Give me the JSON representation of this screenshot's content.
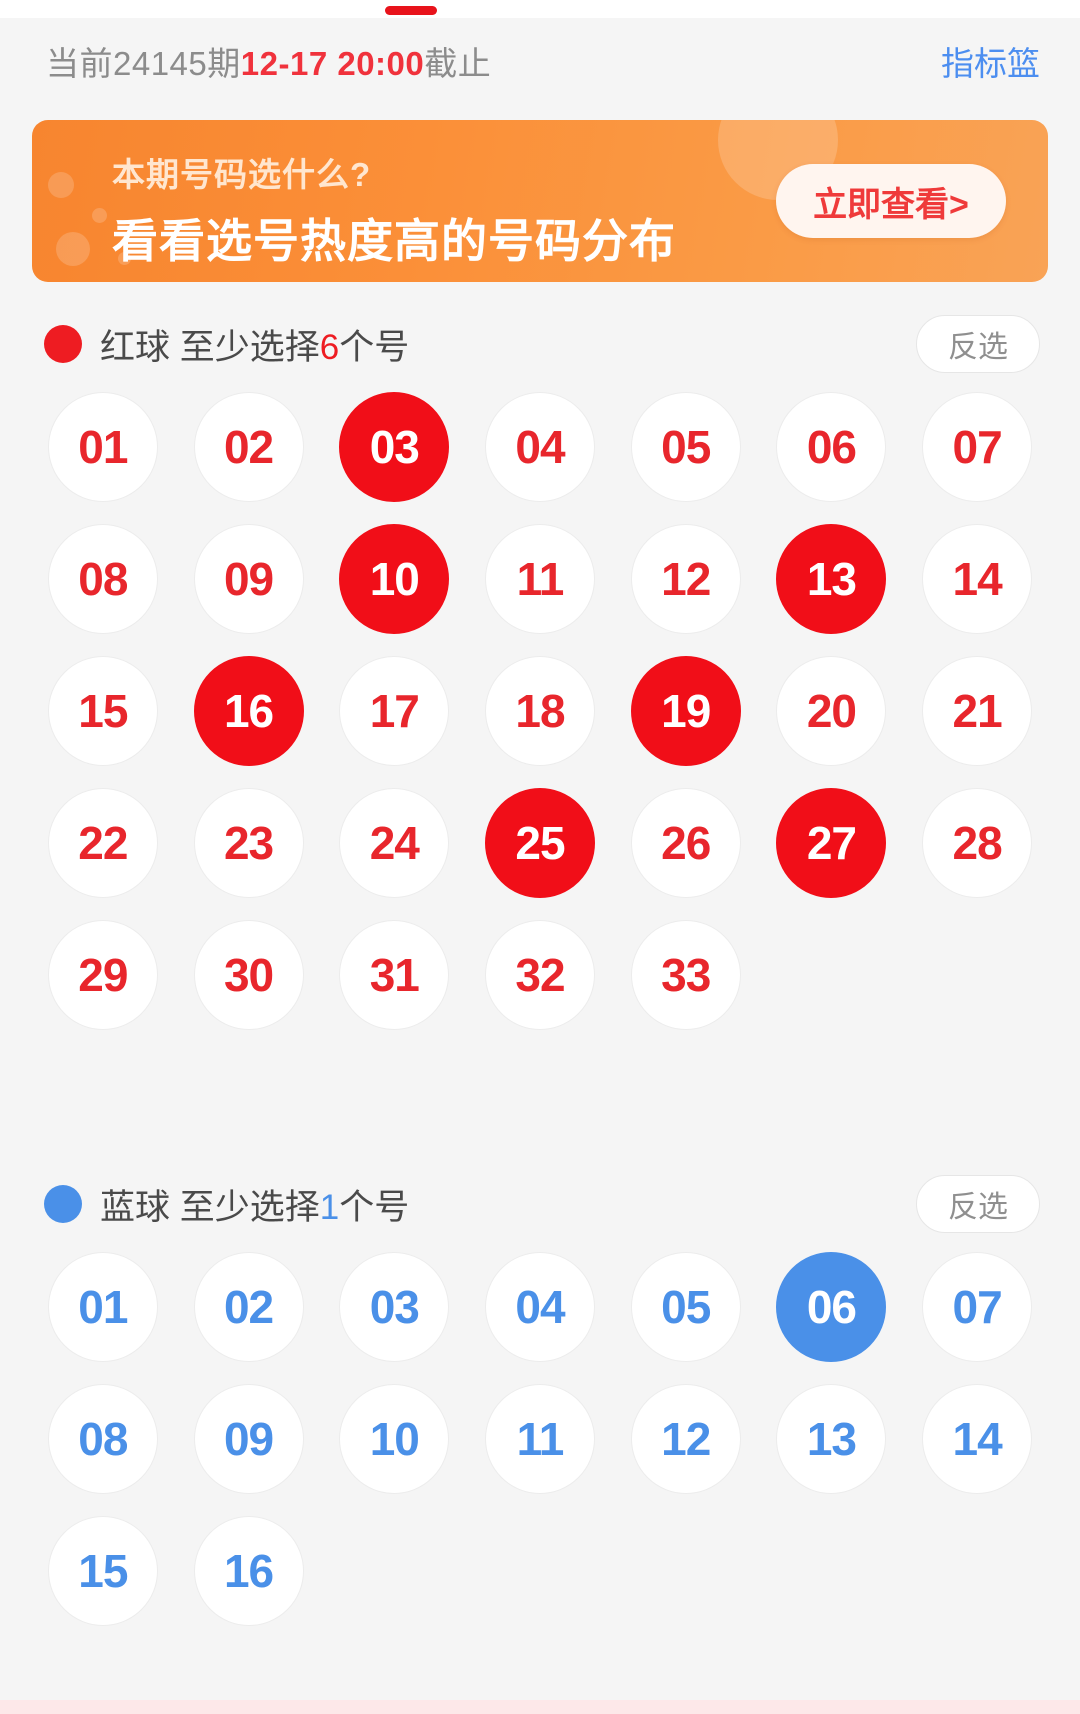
{
  "header": {
    "period_prefix": "当前24145期",
    "deadline_time": "12-17 20:00",
    "period_suffix": "截止",
    "indicator_basket_label": "指标篮"
  },
  "banner": {
    "line1": "本期号码选什么?",
    "line2": "看看选号热度高的号码分布",
    "button_label": "立即查看>",
    "accent_color": "#f7852f"
  },
  "red_section": {
    "dot_color": "#ee1c22",
    "title_prefix": "红球 至少选择",
    "min_count": "6",
    "title_suffix": "个号",
    "invert_label": "反选",
    "balls": [
      {
        "num": "01",
        "selected": false
      },
      {
        "num": "02",
        "selected": false
      },
      {
        "num": "03",
        "selected": true
      },
      {
        "num": "04",
        "selected": false
      },
      {
        "num": "05",
        "selected": false
      },
      {
        "num": "06",
        "selected": false
      },
      {
        "num": "07",
        "selected": false
      },
      {
        "num": "08",
        "selected": false
      },
      {
        "num": "09",
        "selected": false
      },
      {
        "num": "10",
        "selected": true
      },
      {
        "num": "11",
        "selected": false
      },
      {
        "num": "12",
        "selected": false
      },
      {
        "num": "13",
        "selected": true
      },
      {
        "num": "14",
        "selected": false
      },
      {
        "num": "15",
        "selected": false
      },
      {
        "num": "16",
        "selected": true
      },
      {
        "num": "17",
        "selected": false
      },
      {
        "num": "18",
        "selected": false
      },
      {
        "num": "19",
        "selected": true
      },
      {
        "num": "20",
        "selected": false
      },
      {
        "num": "21",
        "selected": false
      },
      {
        "num": "22",
        "selected": false
      },
      {
        "num": "23",
        "selected": false
      },
      {
        "num": "24",
        "selected": false
      },
      {
        "num": "25",
        "selected": true
      },
      {
        "num": "26",
        "selected": false
      },
      {
        "num": "27",
        "selected": true
      },
      {
        "num": "28",
        "selected": false
      },
      {
        "num": "29",
        "selected": false
      },
      {
        "num": "30",
        "selected": false
      },
      {
        "num": "31",
        "selected": false
      },
      {
        "num": "32",
        "selected": false
      },
      {
        "num": "33",
        "selected": false
      }
    ]
  },
  "blue_section": {
    "dot_color": "#4a90e8",
    "title_prefix": "蓝球 至少选择",
    "min_count": "1",
    "title_suffix": "个号",
    "invert_label": "反选",
    "balls": [
      {
        "num": "01",
        "selected": false
      },
      {
        "num": "02",
        "selected": false
      },
      {
        "num": "03",
        "selected": false
      },
      {
        "num": "04",
        "selected": false
      },
      {
        "num": "05",
        "selected": false
      },
      {
        "num": "06",
        "selected": true
      },
      {
        "num": "07",
        "selected": false
      },
      {
        "num": "08",
        "selected": false
      },
      {
        "num": "09",
        "selected": false
      },
      {
        "num": "10",
        "selected": false
      },
      {
        "num": "11",
        "selected": false
      },
      {
        "num": "12",
        "selected": false
      },
      {
        "num": "13",
        "selected": false
      },
      {
        "num": "14",
        "selected": false
      },
      {
        "num": "15",
        "selected": false
      },
      {
        "num": "16",
        "selected": false
      }
    ]
  }
}
